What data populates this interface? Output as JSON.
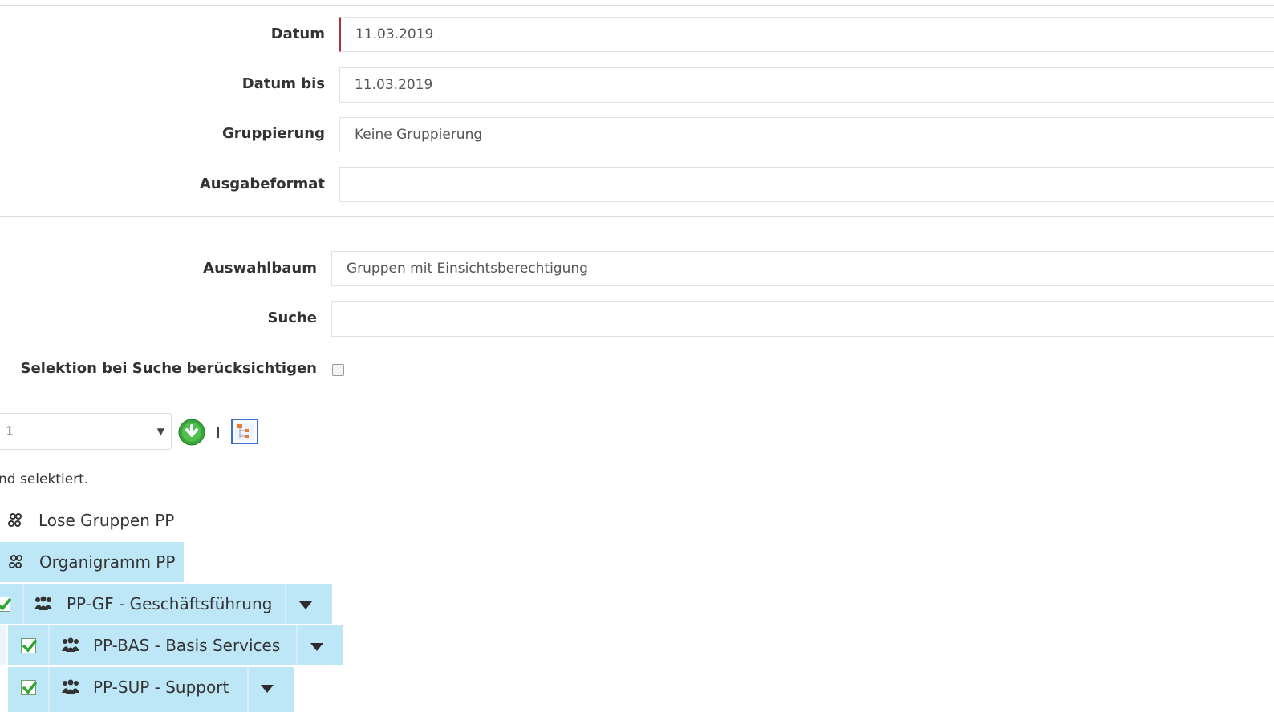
{
  "form": {
    "datum": {
      "label": "Datum",
      "value": "11.03.2019"
    },
    "datum_bis": {
      "label": "Datum bis",
      "value": "11.03.2019"
    },
    "gruppierung": {
      "label": "Gruppierung",
      "value": "Keine Gruppierung"
    },
    "ausgabeformat": {
      "label": "Ausgabeformat",
      "value": ""
    }
  },
  "tree_filter": {
    "auswahlbaum": {
      "label": "Auswahlbaum",
      "value": "Gruppen mit Einsichtsberechtigung"
    },
    "suche": {
      "label": "Suche",
      "value": ""
    },
    "selektion": {
      "label": "Selektion bei Suche berücksichtigen",
      "checked": false
    }
  },
  "toolbar": {
    "level_select_value": "1",
    "level_select_arrow": "▼",
    "expand_icon": "arrow-down-circle-icon",
    "tree_icon": "tree-view-icon"
  },
  "info_text": "nd selektiert.",
  "tree": {
    "nodes": [
      {
        "label": "Lose Gruppen PP",
        "icon": "group-cluster-icon",
        "selected": false
      },
      {
        "label": "Organigramm PP",
        "icon": "group-cluster-icon",
        "selected": true
      },
      {
        "label": "PP-GF - Geschäftsführung",
        "icon": "users-icon",
        "selected": true,
        "checked": true
      },
      {
        "label": "PP-BAS - Basis Services",
        "icon": "users-icon",
        "selected": true,
        "checked": true
      },
      {
        "label": "PP-SUP - Support",
        "icon": "users-icon",
        "selected": true,
        "checked": true
      }
    ]
  },
  "colors": {
    "selected_bg": "#bde6f7",
    "active_field_border": "#b0303a",
    "check_green": "#2fa52f",
    "expand_button_green": "#3aa53a"
  }
}
